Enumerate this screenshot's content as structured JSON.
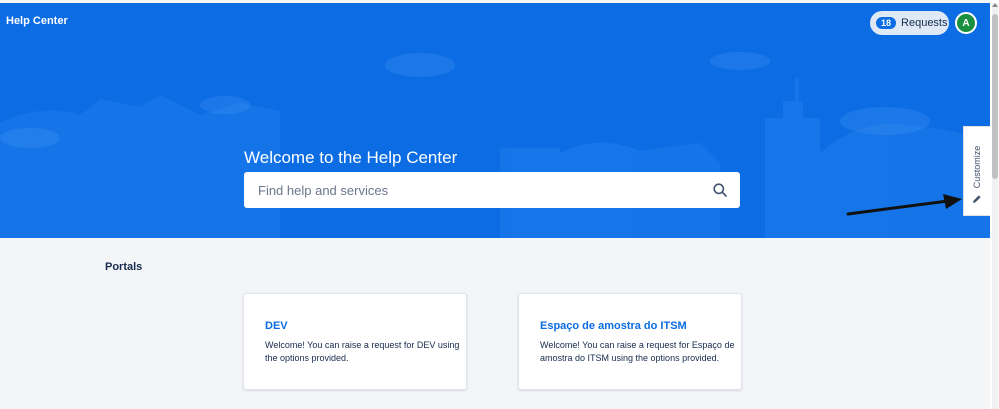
{
  "header": {
    "title": "Help Center",
    "requests_count": "18",
    "requests_label": "Requests",
    "avatar_initial": "A"
  },
  "banner": {
    "welcome_text": "Welcome to the Help Center",
    "background_color": "#0b6ce4"
  },
  "search": {
    "placeholder": "Find help and services",
    "icon": "search-icon"
  },
  "customize": {
    "label": "Customize",
    "icon": "pencil-icon"
  },
  "portals": {
    "heading": "Portals",
    "items": [
      {
        "title": "DEV",
        "description": "Welcome! You can raise a request for DEV using the options provided."
      },
      {
        "title": "Espaço de amostra do ITSM",
        "description": "Welcome! You can raise a request for Espaço de amostra do ITSM using the options provided."
      }
    ]
  },
  "colors": {
    "accent": "#0b6ce4",
    "avatar_bg": "#1a8f3f",
    "page_bg": "#f4f5f7"
  }
}
